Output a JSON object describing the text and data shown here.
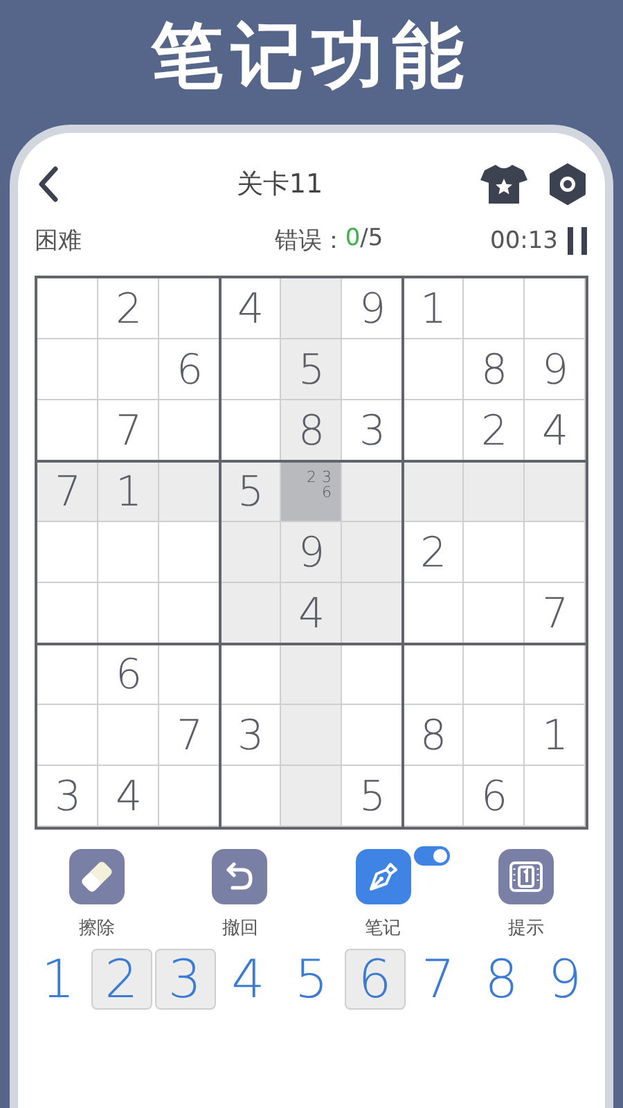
{
  "banner": {
    "title": "笔记功能"
  },
  "header": {
    "title": "关卡11"
  },
  "info": {
    "difficulty": "困难",
    "errors_label": "错误：",
    "errors_count": "0",
    "errors_max": "/5",
    "timer": "00:13"
  },
  "grid": {
    "rows": [
      [
        {
          "selected": false
        },
        {
          "value": "2",
          "selected": false
        },
        {
          "selected": false
        },
        {
          "value": "4",
          "selected": false
        },
        {
          "selected": false
        },
        {
          "value": "9",
          "selected": false
        },
        {
          "value": "1",
          "selected": false
        },
        {
          "selected": false
        },
        {
          "selected": false
        }
      ],
      [
        {
          "selected": false
        },
        {
          "selected": false
        },
        {
          "value": "6",
          "selected": false
        },
        {
          "selected": false
        },
        {
          "value": "5",
          "selected": false
        },
        {
          "selected": false
        },
        {
          "selected": false
        },
        {
          "value": "8",
          "selected": false
        },
        {
          "value": "9",
          "selected": false
        }
      ],
      [
        {
          "selected": false
        },
        {
          "value": "7",
          "selected": false
        },
        {
          "selected": false
        },
        {
          "selected": false
        },
        {
          "value": "8",
          "selected": false
        },
        {
          "value": "3",
          "selected": false
        },
        {
          "selected": false
        },
        {
          "value": "2",
          "selected": false
        },
        {
          "value": "4",
          "selected": false
        }
      ],
      [
        {
          "value": "7",
          "selected": false
        },
        {
          "value": "1",
          "selected": false
        },
        {
          "selected": false
        },
        {
          "value": "5",
          "selected": false
        },
        {
          "notes": [
            "2",
            "3",
            "6"
          ],
          "selected": true
        },
        {
          "selected": false
        },
        {
          "selected": false
        },
        {
          "selected": false
        },
        {
          "selected": false
        }
      ],
      [
        {
          "selected": false
        },
        {
          "selected": false
        },
        {
          "selected": false
        },
        {
          "selected": false
        },
        {
          "value": "9",
          "selected": false
        },
        {
          "selected": false
        },
        {
          "value": "2",
          "selected": false
        },
        {
          "selected": false
        },
        {
          "selected": false
        }
      ],
      [
        {
          "selected": false
        },
        {
          "selected": false
        },
        {
          "selected": false
        },
        {
          "selected": false
        },
        {
          "value": "4",
          "selected": false
        },
        {
          "selected": false
        },
        {
          "selected": false
        },
        {
          "selected": false
        },
        {
          "value": "7",
          "selected": false
        }
      ],
      [
        {
          "selected": false
        },
        {
          "value": "6",
          "selected": false
        },
        {
          "selected": false
        },
        {
          "selected": false
        },
        {
          "selected": false
        },
        {
          "selected": false
        },
        {
          "selected": false
        },
        {
          "selected": false
        },
        {
          "selected": false
        }
      ],
      [
        {
          "selected": false
        },
        {
          "selected": false
        },
        {
          "value": "7",
          "selected": false
        },
        {
          "value": "3",
          "selected": false
        },
        {
          "selected": false
        },
        {
          "selected": false
        },
        {
          "value": "8",
          "selected": false
        },
        {
          "selected": false
        },
        {
          "value": "1",
          "selected": false
        }
      ],
      [
        {
          "value": "3",
          "selected": false
        },
        {
          "value": "4",
          "selected": false
        },
        {
          "selected": false
        },
        {
          "selected": false
        },
        {
          "selected": false
        },
        {
          "value": "5",
          "selected": false
        },
        {
          "selected": false
        },
        {
          "value": "6",
          "selected": false
        },
        {
          "selected": false
        }
      ]
    ]
  },
  "tools": [
    {
      "kind": "erase",
      "label": "擦除",
      "active": false
    },
    {
      "kind": "undo",
      "label": "撤回",
      "active": false
    },
    {
      "kind": "note",
      "label": "笔记",
      "active": true,
      "toggle_on": true
    },
    {
      "kind": "hint",
      "label": "提示",
      "active": false
    }
  ],
  "numpad": [
    {
      "digit": "1",
      "marked": false
    },
    {
      "digit": "2",
      "marked": true
    },
    {
      "digit": "3",
      "marked": true
    },
    {
      "digit": "4",
      "marked": false
    },
    {
      "digit": "5",
      "marked": false
    },
    {
      "digit": "6",
      "marked": true
    },
    {
      "digit": "7",
      "marked": false
    },
    {
      "digit": "8",
      "marked": false
    },
    {
      "digit": "9",
      "marked": false
    }
  ]
}
